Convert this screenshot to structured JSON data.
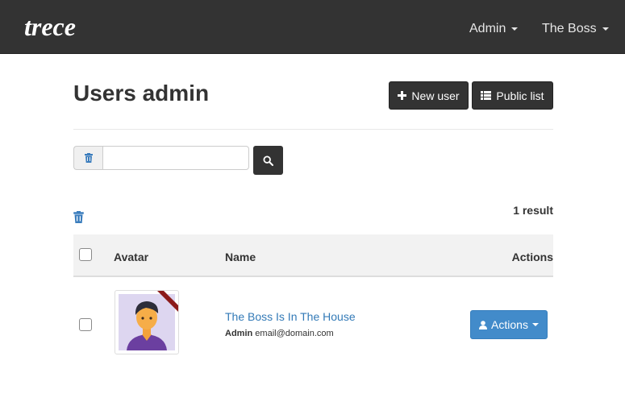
{
  "navbar": {
    "logo_text": "trece",
    "menu_admin": "Admin",
    "menu_user": "The Boss"
  },
  "header": {
    "title": "Users admin",
    "new_user_label": "New user",
    "public_list_label": "Public list"
  },
  "search": {
    "value": "",
    "placeholder": ""
  },
  "results": {
    "count_text": "1 result"
  },
  "table": {
    "columns": [
      "",
      "Avatar",
      "Name",
      "Actions"
    ],
    "rows": [
      {
        "name": "The Boss Is In The House",
        "role": "Admin",
        "email": "email@domain.com",
        "actions_label": "Actions"
      }
    ]
  },
  "colors": {
    "navbar_bg": "#333333",
    "link": "#337ab7",
    "primary_button": "#428bca",
    "avatar_ribbon": "#8b1a1a"
  }
}
